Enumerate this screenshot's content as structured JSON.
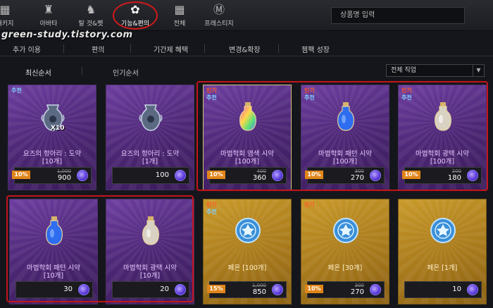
{
  "topbar": {
    "categories": [
      {
        "label": "패키지",
        "icon": "package-icon"
      },
      {
        "label": "아바타",
        "icon": "avatar-icon"
      },
      {
        "label": "탈 것&펫",
        "icon": "horse-icon"
      },
      {
        "label": "기능&편의",
        "icon": "function-icon"
      },
      {
        "label": "전체",
        "icon": "grid-icon"
      },
      {
        "label": "프레스티지",
        "icon": "prestige-icon"
      }
    ],
    "search_placeholder": "상품명 입력"
  },
  "watermark": "green-study.tistory.com",
  "subtabs": [
    "추가 이용",
    "편의",
    "기간제 혜택",
    "변경&확장",
    "젬팩 성장"
  ],
  "sort": {
    "latest": "최신순서",
    "popular": "인기순서"
  },
  "filter": {
    "selected": "전체 직업"
  },
  "products": [
    {
      "name": "요즈의 항아리 : 도약",
      "count": "[10개]",
      "badges": [
        "추천"
      ],
      "qty": "X10",
      "discount": "10%",
      "old_price": "1,000",
      "price": "900",
      "kind": "purple"
    },
    {
      "name": "요즈의 항아리 : 도약",
      "count": "[1개]",
      "badges": [],
      "qty": "",
      "discount": "",
      "old_price": "",
      "price": "100",
      "kind": "purple"
    },
    {
      "name": "마법학회 염색 시약",
      "count": "[100개]",
      "badges": [
        "인기",
        "추천"
      ],
      "qty": "",
      "discount": "10%",
      "old_price": "400",
      "price": "360",
      "kind": "purple"
    },
    {
      "name": "마법학회 패턴 시약",
      "count": "[100개]",
      "badges": [
        "인기",
        "추천"
      ],
      "qty": "",
      "discount": "10%",
      "old_price": "300",
      "price": "270",
      "kind": "purple"
    },
    {
      "name": "마법학회 광택 시약",
      "count": "[100개]",
      "badges": [
        "인기",
        "추천"
      ],
      "qty": "",
      "discount": "10%",
      "old_price": "200",
      "price": "180",
      "kind": "purple"
    },
    {
      "name": "마법학회 패턴 시약",
      "count": "[10개]",
      "badges": [],
      "qty": "",
      "discount": "",
      "old_price": "",
      "price": "30",
      "kind": "purple"
    },
    {
      "name": "마법학회 광택 시약",
      "count": "[10개]",
      "badges": [],
      "qty": "",
      "discount": "",
      "old_price": "",
      "price": "20",
      "kind": "purple"
    },
    {
      "name": "페온 [100개]",
      "count": "",
      "badges": [
        "인기",
        "추천"
      ],
      "qty": "",
      "discount": "15%",
      "old_price": "1,000",
      "price": "850",
      "kind": "gold"
    },
    {
      "name": "페온 [30개]",
      "count": "",
      "badges": [
        "인기"
      ],
      "qty": "",
      "discount": "10%",
      "old_price": "300",
      "price": "270",
      "kind": "gold"
    },
    {
      "name": "페온 [1개]",
      "count": "",
      "badges": [],
      "qty": "",
      "discount": "",
      "old_price": "",
      "price": "10",
      "kind": "gold"
    }
  ]
}
